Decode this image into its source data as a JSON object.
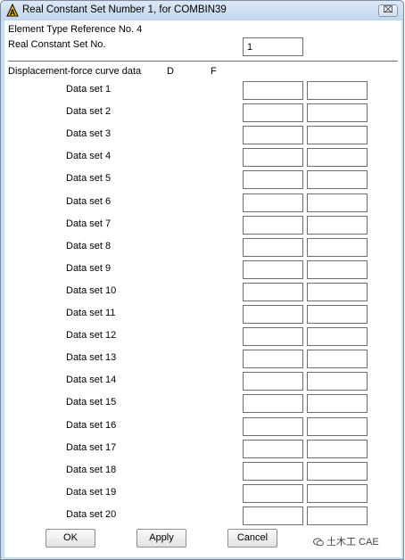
{
  "window": {
    "title": "Real Constant Set Number 1, for COMBIN39",
    "close_label": "⌧"
  },
  "form": {
    "element_type_label": "Element Type Reference No. 4",
    "real_set_label": "Real Constant Set No.",
    "real_set_value": "1",
    "curve_label": "Displacement-force curve data",
    "col_d": "D",
    "col_f": "F",
    "data_sets": [
      {
        "label": "Data set 1",
        "d": "",
        "f": ""
      },
      {
        "label": "Data set 2",
        "d": "",
        "f": ""
      },
      {
        "label": "Data set 3",
        "d": "",
        "f": ""
      },
      {
        "label": "Data set 4",
        "d": "",
        "f": ""
      },
      {
        "label": "Data set 5",
        "d": "",
        "f": ""
      },
      {
        "label": "Data set 6",
        "d": "",
        "f": ""
      },
      {
        "label": "Data set 7",
        "d": "",
        "f": ""
      },
      {
        "label": "Data set 8",
        "d": "",
        "f": ""
      },
      {
        "label": "Data set 9",
        "d": "",
        "f": ""
      },
      {
        "label": "Data set 10",
        "d": "",
        "f": ""
      },
      {
        "label": "Data set 11",
        "d": "",
        "f": ""
      },
      {
        "label": "Data set 12",
        "d": "",
        "f": ""
      },
      {
        "label": "Data set 13",
        "d": "",
        "f": ""
      },
      {
        "label": "Data set 14",
        "d": "",
        "f": ""
      },
      {
        "label": "Data set 15",
        "d": "",
        "f": ""
      },
      {
        "label": "Data set 16",
        "d": "",
        "f": ""
      },
      {
        "label": "Data set 17",
        "d": "",
        "f": ""
      },
      {
        "label": "Data set 18",
        "d": "",
        "f": ""
      },
      {
        "label": "Data set 19",
        "d": "",
        "f": ""
      },
      {
        "label": "Data set 20",
        "d": "",
        "f": ""
      }
    ]
  },
  "buttons": {
    "ok": "OK",
    "apply": "Apply",
    "cancel": "Cancel"
  },
  "watermark": "土木工 CAE",
  "icons": {
    "app": "warning-triangle-icon",
    "wechat": "wechat-icon"
  }
}
